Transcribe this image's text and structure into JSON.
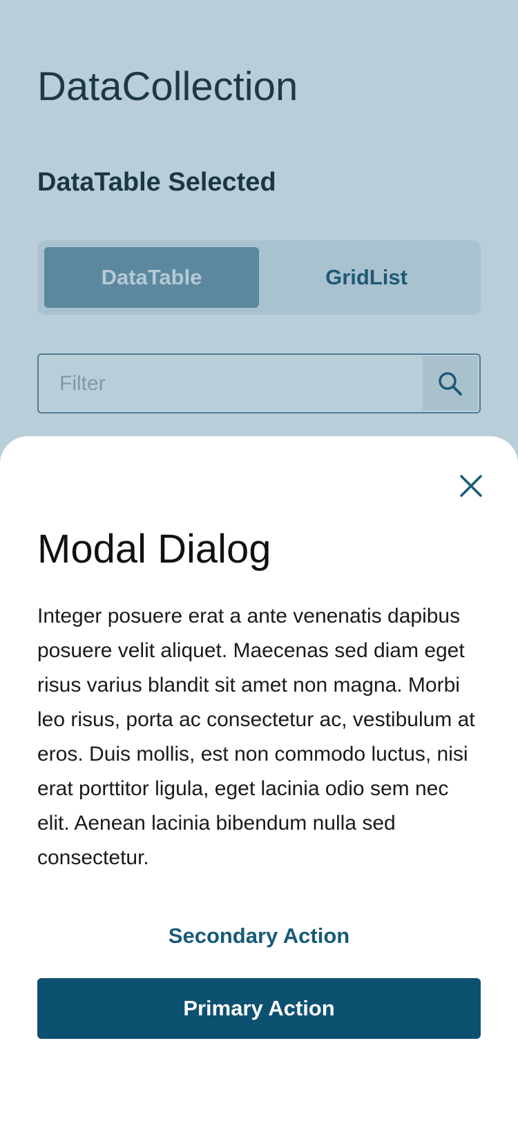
{
  "app": {
    "title": "DataCollection",
    "selection_status": "DataTable Selected"
  },
  "view_switcher": {
    "options": [
      {
        "label": "DataTable",
        "selected": true
      },
      {
        "label": "GridList",
        "selected": false
      }
    ]
  },
  "filter": {
    "value": "",
    "placeholder": "Filter",
    "search_icon": "search-icon"
  },
  "modal": {
    "close_icon": "close-icon",
    "title": "Modal Dialog",
    "body": "Integer posuere erat a ante venenatis dapibus posuere velit aliquet. Maecenas sed diam eget risus varius blandit sit amet non magna. Morbi leo risus, porta ac consectetur ac, vestibulum at eros. Duis mollis, est non commodo luctus, nisi erat porttitor ligula, eget lacinia odio sem nec elit. Aenean lacinia bibendum nulla sed consectetur.",
    "secondary_action_label": "Secondary Action",
    "primary_action_label": "Primary Action"
  },
  "colors": {
    "background": "#b9ced8",
    "accent": "#0d5171",
    "segment_active": "#5b889e",
    "sheet": "#ffffff"
  }
}
